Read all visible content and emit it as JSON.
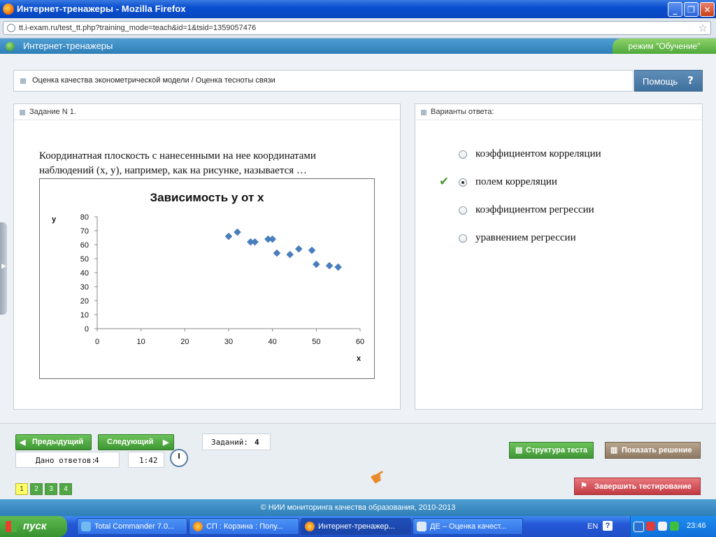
{
  "window": {
    "title": "Интернет-тренажеры - Mozilla Firefox",
    "url": "tt.i-exam.ru/test_tt.php?training_mode=teach&id=1&tsid=1359057476",
    "minimize_glyph": "_",
    "maximize_glyph": "❐",
    "close_glyph": "✕"
  },
  "app": {
    "title": "Интернет-тренажеры",
    "mode_label": "режим \"Обучение\"",
    "topic": "Оценка качества эконометрической модели / Оценка тесноты связи",
    "help_label": "Помощь",
    "help_glyph": "?"
  },
  "task": {
    "header": "Задание N 1.",
    "question_line1": "Координатная плоскость с нанесенными на нее координатами",
    "question_line2": "наблюдений (x, y), например, как на рисунке, называется …"
  },
  "answers": {
    "header": "Варианты ответа:",
    "options": [
      {
        "label": "коэффициентом корреляции",
        "selected": false,
        "correct": false
      },
      {
        "label": "полем корреляции",
        "selected": true,
        "correct": true
      },
      {
        "label": "коэффициентом регрессии",
        "selected": false,
        "correct": false
      },
      {
        "label": "уравнением регрессии",
        "selected": false,
        "correct": false
      }
    ],
    "check_glyph": "✔"
  },
  "navigation": {
    "prev_label": "Предыдущий",
    "next_label": "Следующий",
    "tasks_count_label": "Заданий:",
    "tasks_count": "4",
    "answers_given_label": "Дано ответов:",
    "answers_given": "4",
    "timer": "1:42",
    "pages": [
      "1",
      "2",
      "3",
      "4"
    ],
    "current_page": "1",
    "structure_label": "Структура теста",
    "solution_label": "Показать решение",
    "finish_label": "Завершить тестирование"
  },
  "footer": {
    "text": "© НИИ мониторинга качества образования, 2010-2013"
  },
  "taskbar": {
    "start_label": "пуск",
    "tasks": [
      {
        "label": "Total Commander 7.0...",
        "icon": "total-commander-icon",
        "active": false
      },
      {
        "label": "СП : Корзина : Полу...",
        "icon": "firefox-icon",
        "active": false
      },
      {
        "label": "Интернет-тренажер...",
        "icon": "firefox-icon",
        "active": true
      },
      {
        "label": "ДЕ – Оценка качест...",
        "icon": "word-icon",
        "active": false
      }
    ],
    "lang": "EN",
    "help_glyph": "?",
    "time": "23:46"
  },
  "colors": {
    "accent_blue": "#2f7fb8",
    "mode_green": "#4ea83a",
    "chart_marker": "#4a7fbf"
  },
  "chart_data": {
    "type": "scatter",
    "title": "Зависимость y от x",
    "xlabel": "x",
    "ylabel": "y",
    "xlim": [
      0,
      60
    ],
    "ylim": [
      0,
      80
    ],
    "xticks": [
      0,
      10,
      20,
      30,
      40,
      50,
      60
    ],
    "yticks": [
      0,
      10,
      20,
      30,
      40,
      50,
      60,
      70,
      80
    ],
    "grid": false,
    "legend": "none",
    "points": [
      {
        "x": 30,
        "y": 66
      },
      {
        "x": 32,
        "y": 69
      },
      {
        "x": 35,
        "y": 62
      },
      {
        "x": 36,
        "y": 62
      },
      {
        "x": 39,
        "y": 64
      },
      {
        "x": 40,
        "y": 64
      },
      {
        "x": 41,
        "y": 54
      },
      {
        "x": 44,
        "y": 53
      },
      {
        "x": 46,
        "y": 57
      },
      {
        "x": 49,
        "y": 56
      },
      {
        "x": 50,
        "y": 46
      },
      {
        "x": 53,
        "y": 45
      },
      {
        "x": 55,
        "y": 44
      }
    ]
  }
}
